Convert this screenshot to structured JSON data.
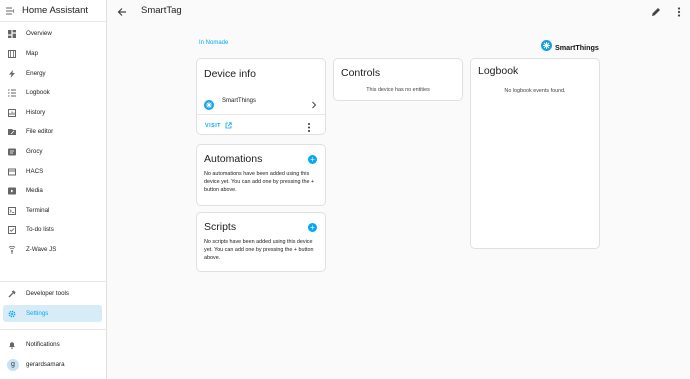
{
  "app": {
    "title": "Home Assistant"
  },
  "sidebar": {
    "items": [
      {
        "label": "Overview",
        "icon": "overview-icon"
      },
      {
        "label": "Map",
        "icon": "map-icon"
      },
      {
        "label": "Energy",
        "icon": "energy-icon"
      },
      {
        "label": "Logbook",
        "icon": "logbook-icon"
      },
      {
        "label": "History",
        "icon": "history-icon"
      },
      {
        "label": "File editor",
        "icon": "file-editor-icon"
      },
      {
        "label": "Grocy",
        "icon": "grocy-icon"
      },
      {
        "label": "HACS",
        "icon": "hacs-icon"
      },
      {
        "label": "Media",
        "icon": "media-icon"
      },
      {
        "label": "Terminal",
        "icon": "terminal-icon"
      },
      {
        "label": "To-do lists",
        "icon": "todo-icon"
      },
      {
        "label": "Z-Wave JS",
        "icon": "zwave-icon"
      }
    ],
    "developer_tools": "Developer tools",
    "settings": "Settings",
    "notifications": "Notifications",
    "user": {
      "name": "gerardsamara",
      "initial": "g"
    },
    "accent": "#03a9f4"
  },
  "header": {
    "title": "SmartTag"
  },
  "area_link": "In Nomade",
  "brand": {
    "name": "SmartThings"
  },
  "device_info": {
    "title": "Device info",
    "integration": "SmartThings",
    "visit": "VISIT"
  },
  "automations": {
    "title": "Automations",
    "text": "No automations have been added using this device yet. You can add one by pressing the + button above."
  },
  "scripts": {
    "title": "Scripts",
    "text": "No scripts have been added using this device yet. You can add one by pressing the + button above."
  },
  "controls": {
    "title": "Controls",
    "empty": "This device has no entities"
  },
  "logbook": {
    "title": "Logbook",
    "empty": "No logbook events found."
  }
}
